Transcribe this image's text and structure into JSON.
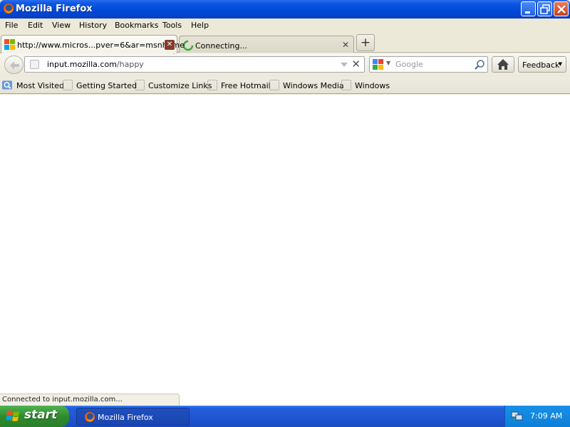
{
  "window": {
    "title": "Mozilla Firefox",
    "icon": "firefox-icon",
    "controls": [
      "minimize-icon",
      "restore-icon",
      "close-icon"
    ]
  },
  "menu": {
    "items": [
      "File",
      "Edit",
      "View",
      "History",
      "Bookmarks",
      "Tools",
      "Help"
    ]
  },
  "tabs": [
    {
      "label": "http://www.micros...pver=6&ar=msnhome",
      "favicon": "windows-logo-icon",
      "active": true
    },
    {
      "label": "Connecting...",
      "favicon": "loading-spinner-icon",
      "active": false
    }
  ],
  "new_tab": "+",
  "navbar": {
    "url_domain": "input.mozilla.com",
    "url_path": "/happy",
    "search_placeholder": "Google",
    "search_engine": "google-icon",
    "feedback_label": "Feedback"
  },
  "bookmarks": [
    "Most Visited",
    "Getting Started",
    "Customize Links",
    "Free Hotmail",
    "Windows Media",
    "Windows"
  ],
  "status": {
    "text": "Connected to input.mozilla.com..."
  },
  "taskbar": {
    "start_label": "start",
    "task_label": "Mozilla Firefox",
    "clock": "7:09 AM"
  },
  "colors": {
    "titlebar": "#0048d8",
    "taskbar": "#245edb",
    "start": "#2e8c2e",
    "tray": "#0f7fd8"
  }
}
